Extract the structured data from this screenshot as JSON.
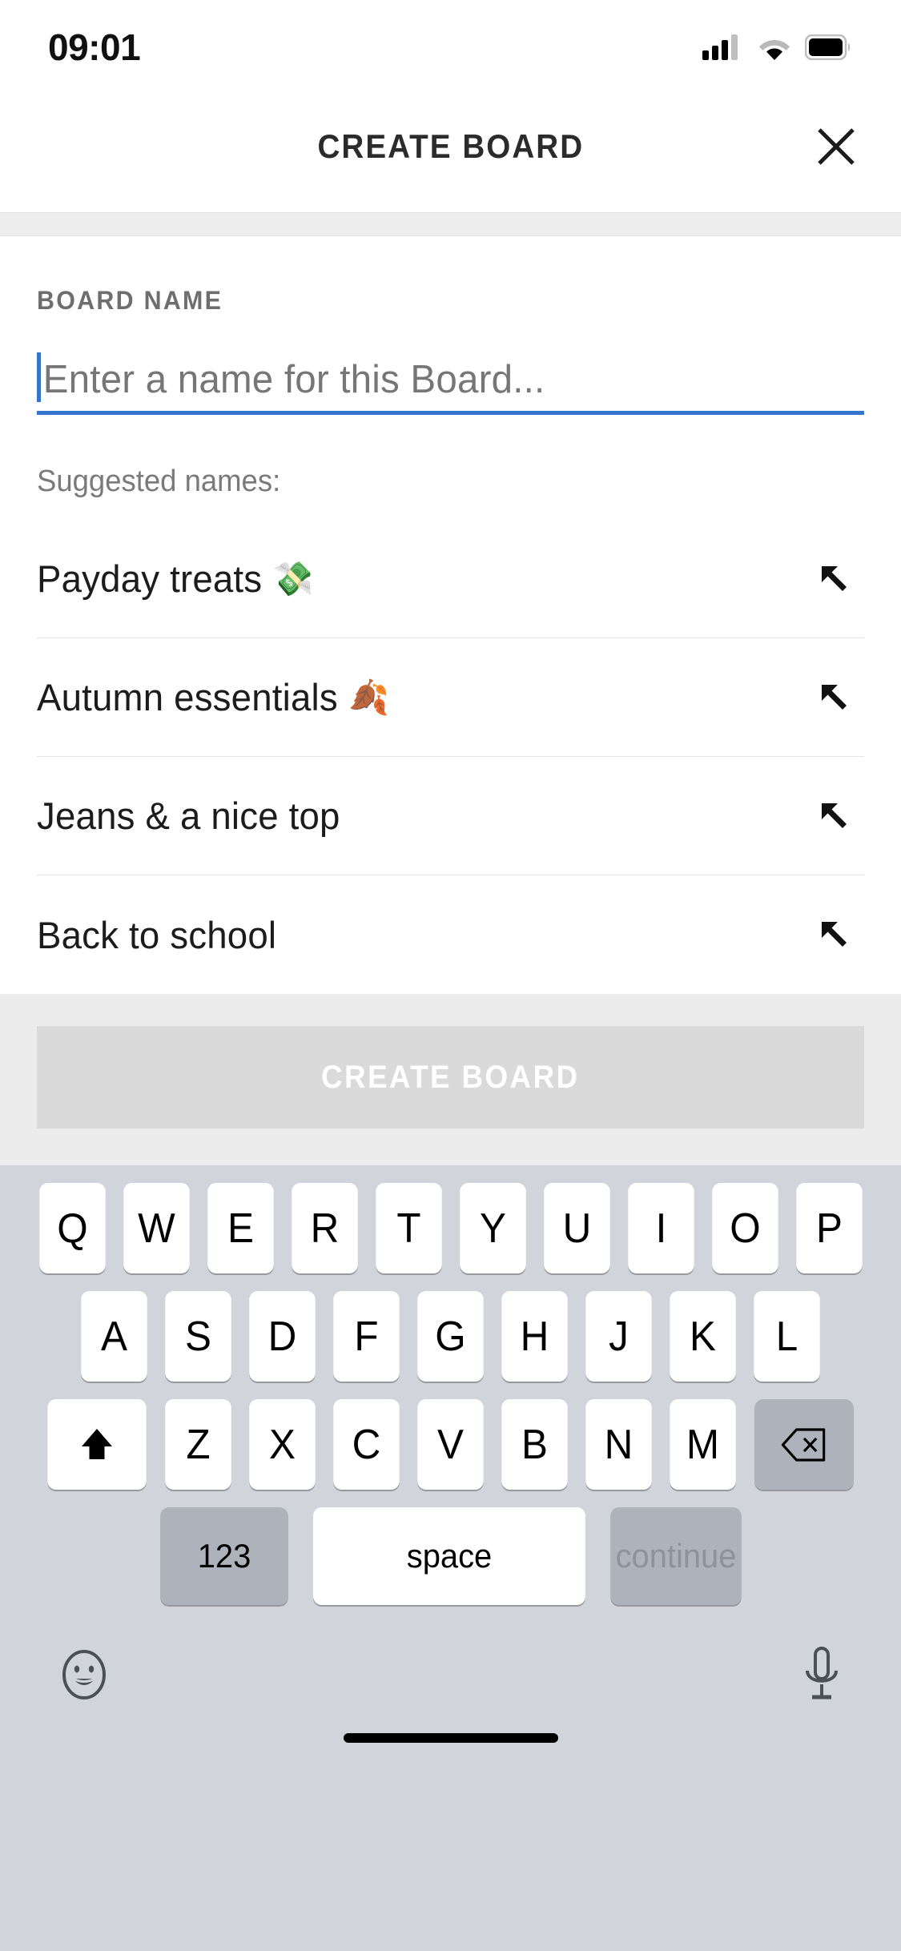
{
  "status_bar": {
    "time": "09:01",
    "signal_icon": "cellular-signal-icon",
    "wifi_icon": "wifi-icon",
    "battery_icon": "battery-icon"
  },
  "header": {
    "title": "CREATE BOARD",
    "close_icon": "close-icon"
  },
  "form": {
    "field_label": "BOARD NAME",
    "input_value": "",
    "input_placeholder": "Enter a name for this Board...",
    "accent_color": "#3575cc",
    "suggest_title": "Suggested names:"
  },
  "suggestions": [
    {
      "label": "Payday treats",
      "emoji": "💸",
      "action_icon": "arrow-up-left-icon"
    },
    {
      "label": "Autumn essentials",
      "emoji": "🍂",
      "action_icon": "arrow-up-left-icon"
    },
    {
      "label": "Jeans & a nice top",
      "emoji": "",
      "action_icon": "arrow-up-left-icon"
    },
    {
      "label": "Back to school",
      "emoji": "",
      "action_icon": "arrow-up-left-icon"
    }
  ],
  "cta": {
    "label": "CREATE BOARD",
    "enabled": false,
    "background": "#dadada",
    "text_color": "#ffffff"
  },
  "keyboard": {
    "background": "#d1d5db",
    "row1": [
      "Q",
      "W",
      "E",
      "R",
      "T",
      "Y",
      "U",
      "I",
      "O",
      "P"
    ],
    "row2": [
      "A",
      "S",
      "D",
      "F",
      "G",
      "H",
      "J",
      "K",
      "L"
    ],
    "row3": [
      "Z",
      "X",
      "C",
      "V",
      "B",
      "N",
      "M"
    ],
    "shift_icon": "shift-arrow-icon",
    "backspace_icon": "backspace-icon",
    "numbers_key": "123",
    "space_key": "space",
    "return_key": "continue",
    "emoji_icon": "emoji-smiley-icon",
    "dictation_icon": "microphone-icon"
  }
}
